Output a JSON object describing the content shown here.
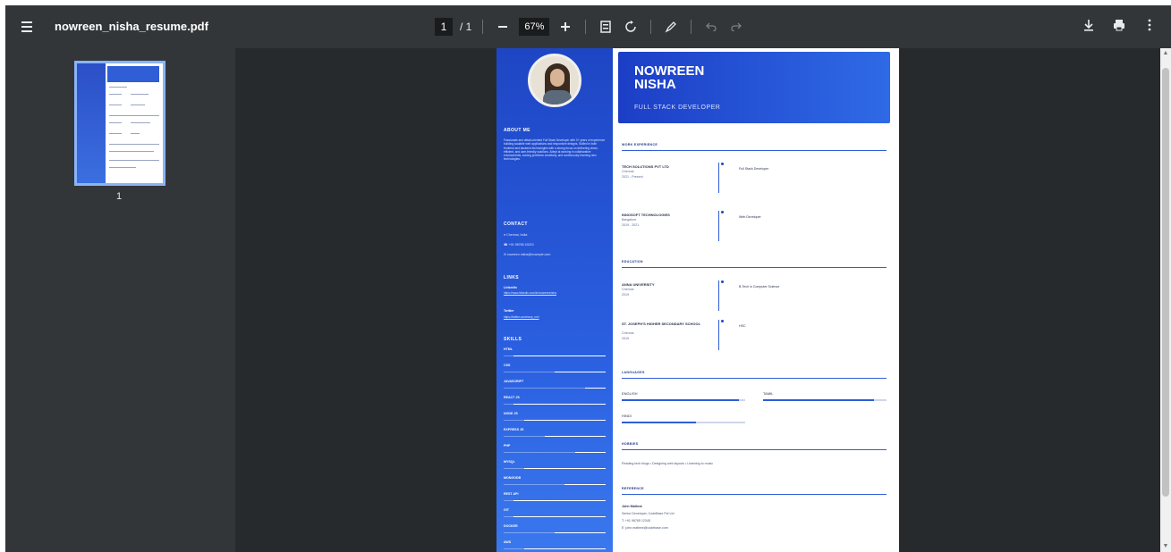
{
  "toolbar": {
    "title": "nowreen_nisha_resume.pdf",
    "page_current": "1",
    "page_total": "/ 1",
    "zoom": "67%"
  },
  "sidebar": {
    "thumb_label": "1"
  },
  "resume": {
    "name_line1": "NOWREEN",
    "name_line2": "NISHA",
    "role": "FULL STACK DEVELOPER",
    "about_heading": "ABOUT ME",
    "about_text": "Passionate and detail-oriented Full Stack Developer with 3+ years of experience building scalable web applications and responsive designs. Skilled in both frontend and backend technologies with a strong focus on delivering clean, efficient, and user-friendly solutions. Adept at working in collaborative environments, solving problems creatively, and continuously learning new technologies.",
    "contact_heading": "CONTACT",
    "contact_location": "Chennai, India",
    "contact_phone": "+91 98765 43210",
    "contact_email": "nowreen.nisha@example.com",
    "links_heading": "LINKS",
    "linkedin_label": "LinkedIn",
    "linkedin_url": "https://www.linkedin.com/in/nowreennisha",
    "twitter_label": "Twitter",
    "twitter_url": "https://twitter.com/nwrp_nsh",
    "skills_heading": "SKILLS",
    "skills": [
      {
        "name": "HTML",
        "level": 0.9
      },
      {
        "name": "CSS",
        "level": 0.5
      },
      {
        "name": "JAVASCRIPT",
        "level": 0.2
      },
      {
        "name": "REACT JS",
        "level": 0.9
      },
      {
        "name": "NODE JS",
        "level": 0.8
      },
      {
        "name": "EXPRESS JS",
        "level": 0.6
      },
      {
        "name": "PHP",
        "level": 0.3
      },
      {
        "name": "MYSQL",
        "level": 0.8
      },
      {
        "name": "MONGODB",
        "level": 0.4
      },
      {
        "name": "REST API",
        "level": 0.9
      },
      {
        "name": "GIT",
        "level": 0.9
      },
      {
        "name": "DOCKER",
        "level": 0.5
      },
      {
        "name": "AWS",
        "level": 0.8
      }
    ],
    "work_heading": "WORK EXPERIENCE",
    "work": [
      {
        "org": "TECH SOLUTIONS PVT LTD",
        "place": "Chennai",
        "dates": "2021 - Present",
        "role": "Full Stack Developer"
      },
      {
        "org": "INNOSOFT TECHNOLOGIES",
        "place": "Bangalore",
        "dates": "2019 - 2021",
        "role": "Web Developer"
      }
    ],
    "edu_heading": "EDUCATION",
    "education": [
      {
        "org": "ANNA UNIVERSITY",
        "place": "Chennai",
        "dates": "2019",
        "role": "B.Tech in Computer Science"
      },
      {
        "org": "ST. JOSEPH'S HIGHER SECONDARY SCHOOL",
        "place": "Chennai",
        "dates": "2015",
        "role": "HSC"
      }
    ],
    "lang_heading": "LANGUAGES",
    "languages": [
      {
        "name": "ENGLISH",
        "level": 0.95
      },
      {
        "name": "TAMIL",
        "level": 0.9
      },
      {
        "name": "HINDI",
        "level": 0.6
      }
    ],
    "hobbies_heading": "HOBBIES",
    "hobbies_text": "Reading tech blogs • Designing web layouts • Listening to music",
    "ref_heading": "REFERENCE",
    "ref_name": "John Mathew",
    "ref_title": "Senior Developer, CodeBase Pvt Ltd",
    "ref_phone": "T: +91 98765 12345",
    "ref_email": "E: john.mathew@codebase.com"
  },
  "colors": {
    "accent": "#2f5ed6",
    "toolbar": "#323639",
    "viewer_bg": "#272a2c"
  }
}
